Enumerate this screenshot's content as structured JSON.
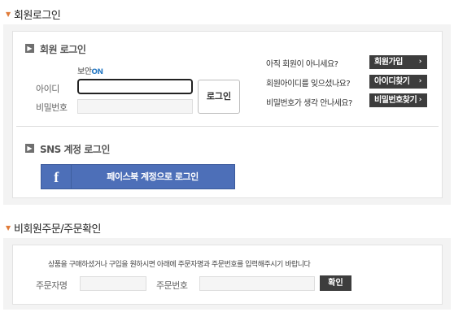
{
  "member_section": {
    "heading": "회원로그인",
    "login": {
      "title": "회원 로그인",
      "security_label": "보안",
      "security_status": "ON",
      "id_label": "아이디",
      "password_label": "비밀번호",
      "id_value": "",
      "password_value": "",
      "login_button": "로그인"
    },
    "help": [
      {
        "question": "아직 회원이 아니세요?",
        "button": "회원가입"
      },
      {
        "question": "회원아이디를 잊으셨나요?",
        "button": "아이디찾기"
      },
      {
        "question": "비밀번호가 생각 안나세요?",
        "button": "비밀번호찾기"
      }
    ],
    "sns": {
      "title": "SNS 계정 로그인",
      "facebook_icon_text": "f",
      "facebook_button": "페이스북 계정으로 로그인"
    }
  },
  "guest_section": {
    "heading": "비회원주문/주문확인",
    "guide": "상품을 구매하셨거나 구입을 원하시면 아래에 주문자명과 주문번호를 입력해주시기 바랍니다",
    "orderer_label": "주문자명",
    "order_number_label": "주문번호",
    "orderer_value": "",
    "order_number_value": "",
    "confirm_button": "확인"
  },
  "colors": {
    "accent_on": "#2a7bc4",
    "caret": "#e07b39",
    "facebook": "#4d6fb8",
    "dark_button": "#3d3d3d"
  }
}
